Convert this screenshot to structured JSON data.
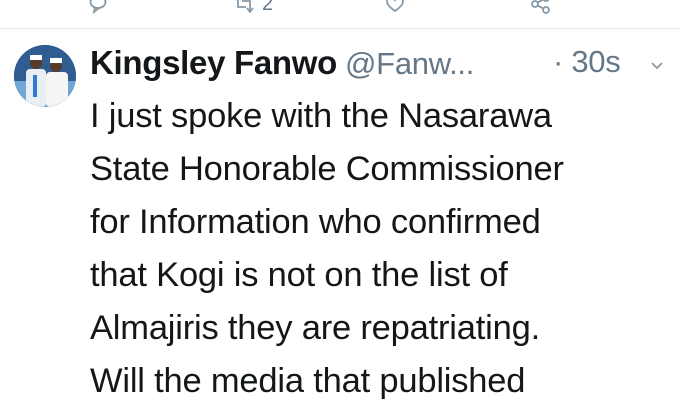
{
  "previous_tweet_actions": {
    "reply_icon": "reply-icon",
    "retweet_icon": "retweet-icon",
    "retweet_count": "2",
    "like_icon": "heart-icon",
    "share_icon": "share-icon"
  },
  "tweet": {
    "author_name": "Kingsley Fanwo",
    "handle": "@Fanw...",
    "time": "· 30s",
    "menu_icon": "chevron-down-icon",
    "lines": [
      "I just spoke with the Nasarawa",
      "State Honorable Commissioner",
      "for Information who confirmed",
      "that Kogi is not on the list of",
      "Almajiris they are repatriating.",
      "Will the media that published"
    ]
  },
  "colors": {
    "text": "#14171a",
    "muted": "#657786",
    "icon": "#8899a6",
    "divider": "#e1e8ed"
  }
}
